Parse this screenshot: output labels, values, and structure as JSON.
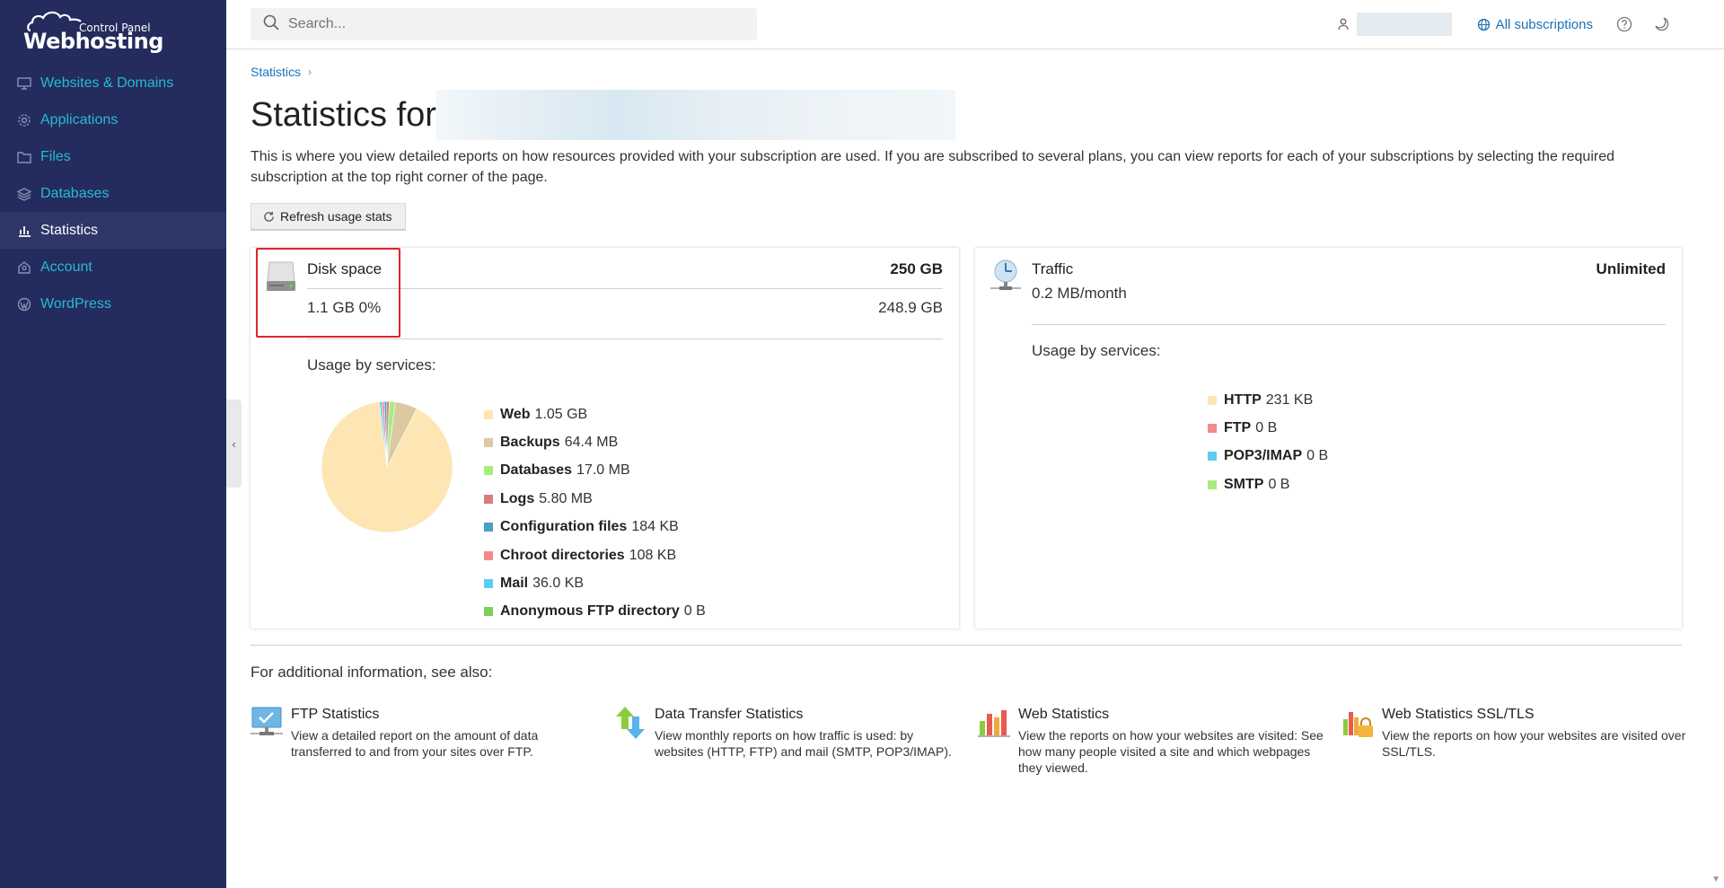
{
  "sidebar": {
    "logo_small": "Control Panel",
    "logo_big": "Webhosting",
    "items": [
      {
        "label": "Websites & Domains",
        "icon": "monitor-icon"
      },
      {
        "label": "Applications",
        "icon": "gear-icon"
      },
      {
        "label": "Files",
        "icon": "folder-icon"
      },
      {
        "label": "Databases",
        "icon": "database-icon"
      },
      {
        "label": "Statistics",
        "icon": "bar-chart-icon",
        "active": true
      },
      {
        "label": "Account",
        "icon": "account-icon"
      },
      {
        "label": "WordPress",
        "icon": "wordpress-icon"
      }
    ]
  },
  "topbar": {
    "search_placeholder": "Search...",
    "subscriptions_label": "All subscriptions"
  },
  "breadcrumb": {
    "item": "Statistics",
    "separator": "›"
  },
  "page": {
    "title": "Statistics for",
    "intro": "This is where you view detailed reports on how resources provided with your subscription are used. If you are subscribed to several plans, you can view reports for each of your subscriptions by selecting the required subscription at the top right corner of the page.",
    "refresh_label": "Refresh usage stats"
  },
  "disk": {
    "name": "Disk space",
    "limit": "250 GB",
    "used": "1.1 GB 0%",
    "free": "248.9 GB",
    "usage_label": "Usage by services:",
    "legend": [
      {
        "name": "Web",
        "value": "1.05 GB",
        "color": "#fde6b3"
      },
      {
        "name": "Backups",
        "value": "64.4 MB",
        "color": "#dcc9a2"
      },
      {
        "name": "Databases",
        "value": "17.0 MB",
        "color": "#a8ec7c"
      },
      {
        "name": "Logs",
        "value": "5.80 MB",
        "color": "#d97c80"
      },
      {
        "name": "Configuration files",
        "value": "184 KB",
        "color": "#4a9fc8"
      },
      {
        "name": "Chroot directories",
        "value": "108 KB",
        "color": "#f28a8a"
      },
      {
        "name": "Mail",
        "value": "36.0 KB",
        "color": "#5ccdf0"
      },
      {
        "name": "Anonymous FTP directory",
        "value": "0 B",
        "color": "#7bd15a"
      }
    ]
  },
  "traffic": {
    "name": "Traffic",
    "limit": "Unlimited",
    "used": "0.2 MB/month",
    "usage_label": "Usage by services:",
    "legend": [
      {
        "name": "HTTP",
        "value": "231 KB",
        "color": "#fde6b3"
      },
      {
        "name": "FTP",
        "value": "0 B",
        "color": "#f28a8a"
      },
      {
        "name": "POP3/IMAP",
        "value": "0 B",
        "color": "#5ccdf0"
      },
      {
        "name": "SMTP",
        "value": "0 B",
        "color": "#a8ec7c"
      }
    ]
  },
  "also": {
    "label": "For additional information, see also:",
    "links": [
      {
        "title": "FTP Statistics",
        "desc": "View a detailed report on the amount of data transferred to and from your sites over FTP.",
        "icon": "ftp-stats-icon"
      },
      {
        "title": "Data Transfer Statistics",
        "desc": "View monthly reports on how traffic is used: by websites (HTTP, FTP) and mail (SMTP, POP3/IMAP).",
        "icon": "data-transfer-icon"
      },
      {
        "title": "Web Statistics",
        "desc": "View the reports on how your websites are visited: See how many people visited a site and which webpages they viewed.",
        "icon": "web-stats-icon"
      },
      {
        "title": "Web Statistics SSL/TLS",
        "desc": "View the reports on how your websites are visited over SSL/TLS.",
        "icon": "web-stats-ssl-icon"
      }
    ]
  }
}
